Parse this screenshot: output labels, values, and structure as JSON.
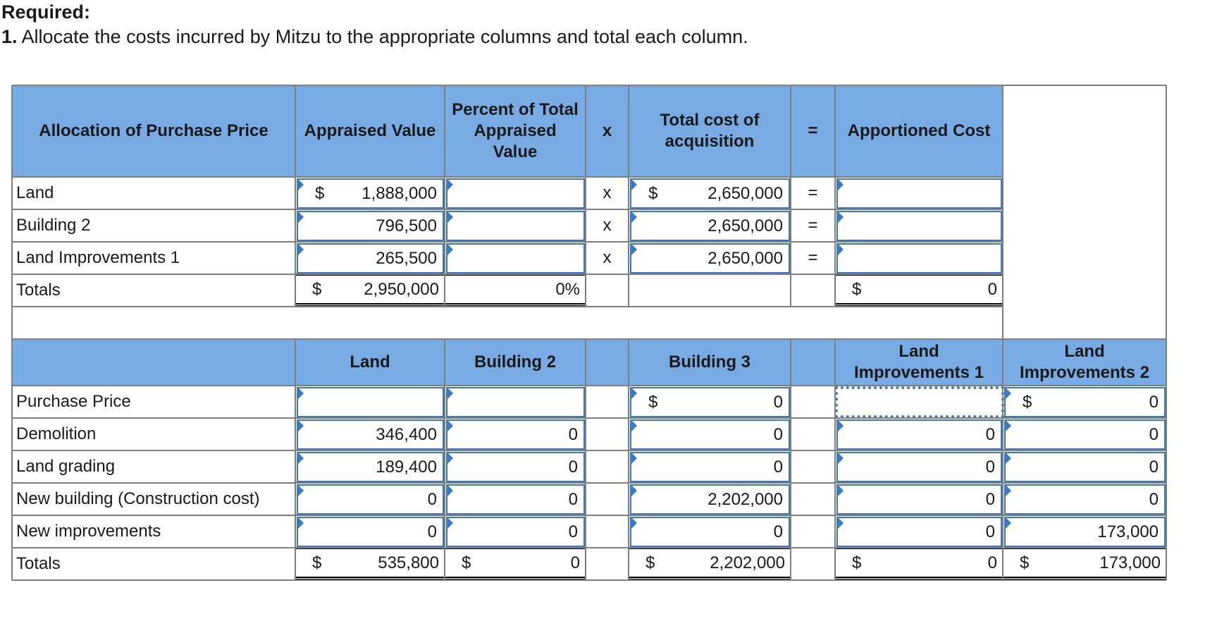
{
  "heading": {
    "required_label": "Required:",
    "instruction_number": "1.",
    "instruction_text": " Allocate the costs incurred by Mitzu to the appropriate columns and total each column."
  },
  "allocation_table": {
    "headers": {
      "label": "Allocation of Purchase Price",
      "appraised_value": "Appraised Value",
      "percent": "Percent of Total Appraised Value",
      "times": "x",
      "total_cost": "Total cost of acquisition",
      "equals": "=",
      "apportioned": "Apportioned Cost"
    },
    "rows": [
      {
        "label": "Land",
        "appraised_dollar": "$",
        "appraised": "1,888,000",
        "percent": "",
        "times": "x",
        "cost_dollar": "$",
        "cost": "2,650,000",
        "equals": "=",
        "apportioned": ""
      },
      {
        "label": "Building 2",
        "appraised_dollar": "",
        "appraised": "796,500",
        "percent": "",
        "times": "x",
        "cost_dollar": "",
        "cost": "2,650,000",
        "equals": "=",
        "apportioned": ""
      },
      {
        "label": "Land Improvements 1",
        "appraised_dollar": "",
        "appraised": "265,500",
        "percent": "",
        "times": "x",
        "cost_dollar": "",
        "cost": "2,650,000",
        "equals": "=",
        "apportioned": ""
      }
    ],
    "totals": {
      "label": "Totals",
      "appraised_dollar": "$",
      "appraised": "2,950,000",
      "percent": "0%",
      "apportioned_dollar": "$",
      "apportioned": "0"
    }
  },
  "cost_table": {
    "headers": [
      "",
      "Land",
      "Building 2",
      "",
      "Building 3",
      "",
      "Land Improvements 1",
      "Land Improvements 2"
    ],
    "rows": [
      {
        "label": "Purchase Price",
        "land": "",
        "building2": "",
        "building3_dollar": "$",
        "building3": "0",
        "li1": "",
        "li2_dollar": "$",
        "li2": "0"
      },
      {
        "label": "Demolition",
        "land": "346,400",
        "building2": "0",
        "building3_dollar": "",
        "building3": "0",
        "li1": "0",
        "li2_dollar": "",
        "li2": "0"
      },
      {
        "label": "Land grading",
        "land": "189,400",
        "building2": "0",
        "building3_dollar": "",
        "building3": "0",
        "li1": "0",
        "li2_dollar": "",
        "li2": "0"
      },
      {
        "label": "New building (Construction cost)",
        "land": "0",
        "building2": "0",
        "building3_dollar": "",
        "building3": "2,202,000",
        "li1": "0",
        "li2_dollar": "",
        "li2": "0"
      },
      {
        "label": "New improvements",
        "land": "0",
        "building2": "0",
        "building3_dollar": "",
        "building3": "0",
        "li1": "0",
        "li2_dollar": "",
        "li2": "173,000"
      }
    ],
    "totals": {
      "label": "Totals",
      "land_dollar": "$",
      "land": "535,800",
      "building2_dollar": "$",
      "building2": "0",
      "building3_dollar": "$",
      "building3": "2,202,000",
      "li1_dollar": "$",
      "li1": "0",
      "li2_dollar": "$",
      "li2": "173,000"
    }
  },
  "colors": {
    "header_fill": "#78abe3",
    "input_border": "#3d76b9",
    "grid_line": "#7f7f7f"
  }
}
